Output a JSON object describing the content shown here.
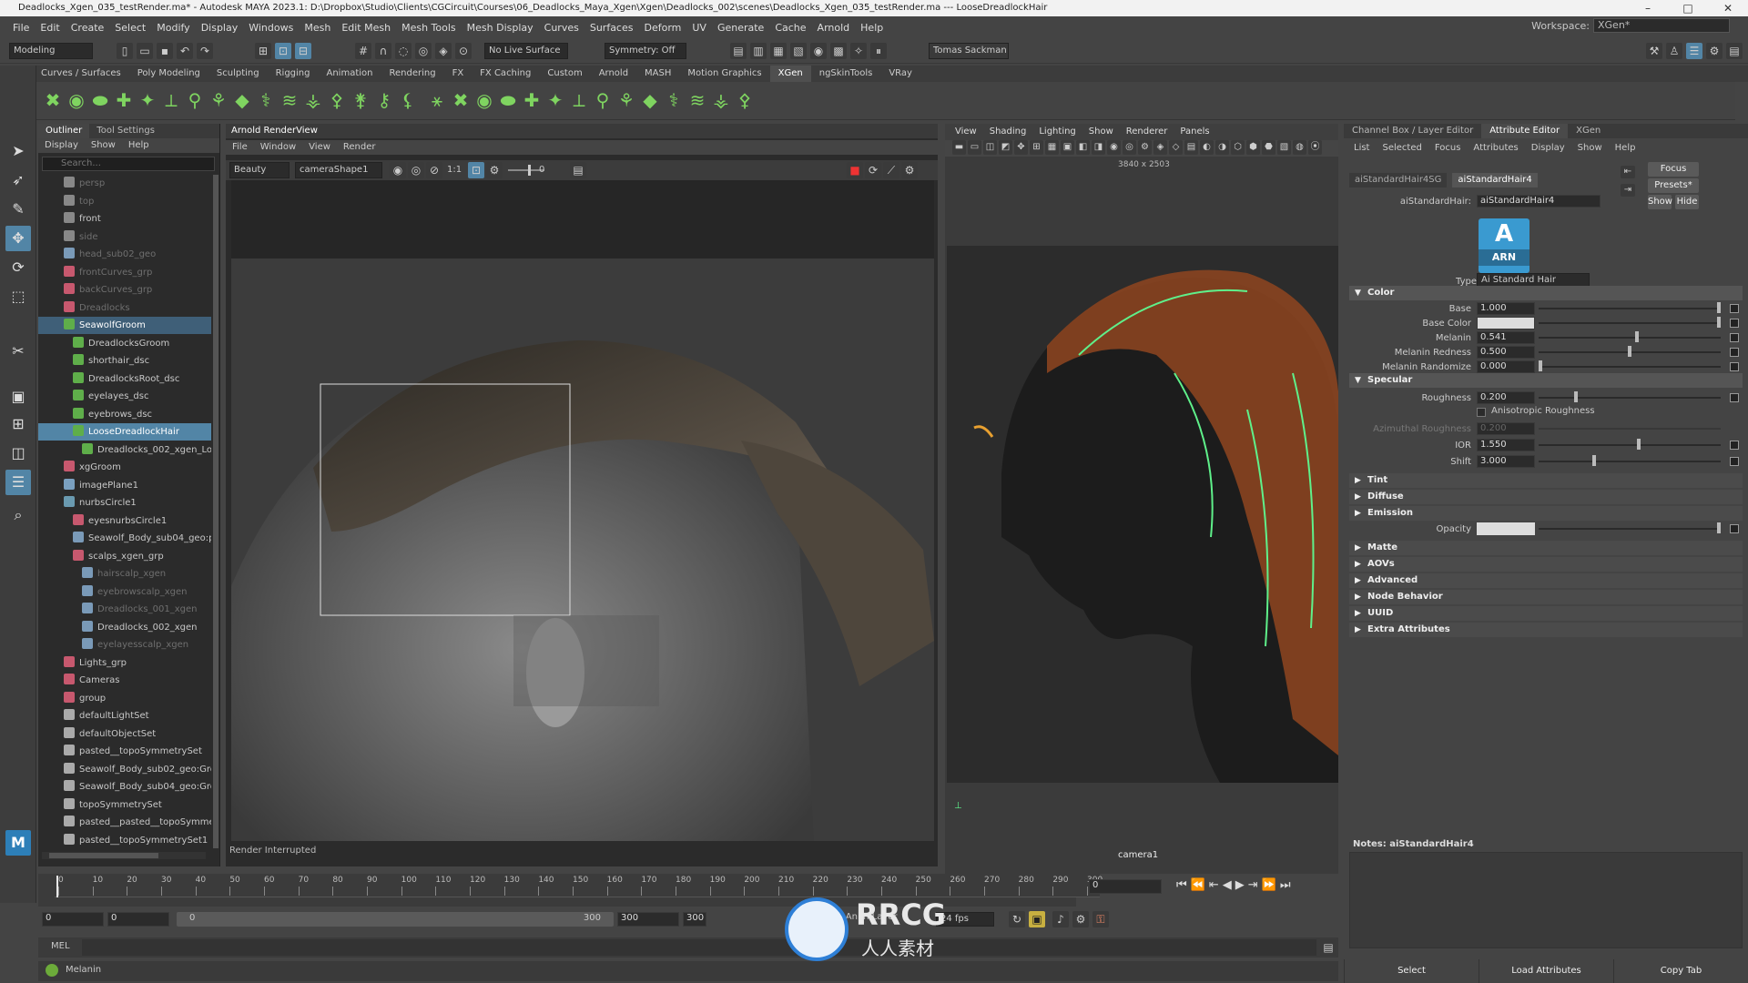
{
  "titlebar": {
    "text": "Deadlocks_Xgen_035_testRender.ma* - Autodesk MAYA 2023.1: D:\\Dropbox\\Studio\\Clients\\CGCircuit\\Courses\\06_Deadlocks_Maya_Xgen\\Xgen\\Deadlocks_002\\scenes\\Deadlocks_Xgen_035_testRender.ma --- LooseDreadlockHair"
  },
  "menubar": [
    "File",
    "Edit",
    "Create",
    "Select",
    "Modify",
    "Display",
    "Windows",
    "Mesh",
    "Edit Mesh",
    "Mesh Tools",
    "Mesh Display",
    "Curves",
    "Surfaces",
    "Deform",
    "UV",
    "Generate",
    "Cache",
    "Arnold",
    "Help"
  ],
  "workspace": {
    "label": "Workspace:",
    "value": "XGen*"
  },
  "statusline": {
    "mode": "Modeling",
    "live_surface": "No Live Surface",
    "symmetry": "Symmetry: Off",
    "user": "Tomas Sackman"
  },
  "shelf_tabs": [
    "Curves / Surfaces",
    "Poly Modeling",
    "Sculpting",
    "Rigging",
    "Animation",
    "Rendering",
    "FX",
    "FX Caching",
    "Custom",
    "Arnold",
    "MASH",
    "Motion Graphics",
    "XGen",
    "ngSkinTools",
    "VRay"
  ],
  "shelf_active": "XGen",
  "outliner": {
    "tabs": [
      "Outliner",
      "Tool Settings"
    ],
    "menu": [
      "Display",
      "Show",
      "Help"
    ],
    "search_placeholder": "Search...",
    "rows": [
      {
        "label": "persp",
        "indent": 2,
        "type": "camera",
        "state": "dim"
      },
      {
        "label": "top",
        "indent": 2,
        "type": "camera",
        "state": "dim"
      },
      {
        "label": "front",
        "indent": 2,
        "type": "camera",
        "state": ""
      },
      {
        "label": "side",
        "indent": 2,
        "type": "camera",
        "state": "dim"
      },
      {
        "label": "head_sub02_geo",
        "indent": 2,
        "type": "mesh",
        "state": "dim"
      },
      {
        "label": "frontCurves_grp",
        "indent": 2,
        "type": "group",
        "state": "dim"
      },
      {
        "label": "backCurves_grp",
        "indent": 2,
        "type": "group",
        "state": "dim"
      },
      {
        "label": "Dreadlocks",
        "indent": 2,
        "type": "group",
        "state": "dim"
      },
      {
        "label": "SeawolfGroom",
        "indent": 2,
        "type": "xgen",
        "state": "sel2"
      },
      {
        "label": "DreadlocksGroom",
        "indent": 3,
        "type": "xgen",
        "state": ""
      },
      {
        "label": "shorthair_dsc",
        "indent": 3,
        "type": "xgen",
        "state": ""
      },
      {
        "label": "DreadlocksRoot_dsc",
        "indent": 3,
        "type": "xgen",
        "state": ""
      },
      {
        "label": "eyelayes_dsc",
        "indent": 3,
        "type": "xgen",
        "state": ""
      },
      {
        "label": "eyebrows_dsc",
        "indent": 3,
        "type": "xgen",
        "state": ""
      },
      {
        "label": "LooseDreadlockHair",
        "indent": 3,
        "type": "xgen",
        "state": "sel"
      },
      {
        "label": "Dreadlocks_002_xgen_Lo",
        "indent": 4,
        "type": "patch",
        "state": ""
      },
      {
        "label": "xgGroom",
        "indent": 2,
        "type": "group",
        "state": ""
      },
      {
        "label": "imagePlane1",
        "indent": 2,
        "type": "image",
        "state": ""
      },
      {
        "label": "nurbsCircle1",
        "indent": 2,
        "type": "curve",
        "state": ""
      },
      {
        "label": "eyesnurbsCircle1",
        "indent": 3,
        "type": "group",
        "state": ""
      },
      {
        "label": "Seawolf_Body_sub04_geo:pl",
        "indent": 3,
        "type": "mesh",
        "state": ""
      },
      {
        "label": "scalps_xgen_grp",
        "indent": 3,
        "type": "group",
        "state": ""
      },
      {
        "label": "hairscalp_xgen",
        "indent": 4,
        "type": "mesh",
        "state": "dim"
      },
      {
        "label": "eyebrowscalp_xgen",
        "indent": 4,
        "type": "mesh",
        "state": "dim"
      },
      {
        "label": "Dreadlocks_001_xgen",
        "indent": 4,
        "type": "mesh",
        "state": "dim"
      },
      {
        "label": "Dreadlocks_002_xgen",
        "indent": 4,
        "type": "mesh",
        "state": ""
      },
      {
        "label": "eyelayesscalp_xgen",
        "indent": 4,
        "type": "mesh",
        "state": "dim"
      },
      {
        "label": "Lights_grp",
        "indent": 2,
        "type": "group",
        "state": ""
      },
      {
        "label": "Cameras",
        "indent": 2,
        "type": "group",
        "state": ""
      },
      {
        "label": "group",
        "indent": 2,
        "type": "group",
        "state": ""
      },
      {
        "label": "defaultLightSet",
        "indent": 2,
        "type": "set",
        "state": ""
      },
      {
        "label": "defaultObjectSet",
        "indent": 2,
        "type": "set",
        "state": ""
      },
      {
        "label": "pasted__topoSymmetrySet",
        "indent": 2,
        "type": "set",
        "state": ""
      },
      {
        "label": "Seawolf_Body_sub02_geo:Grou",
        "indent": 2,
        "type": "set",
        "state": ""
      },
      {
        "label": "Seawolf_Body_sub04_geo:Grou",
        "indent": 2,
        "type": "set",
        "state": ""
      },
      {
        "label": "topoSymmetrySet",
        "indent": 2,
        "type": "set",
        "state": ""
      },
      {
        "label": "pasted__pasted__topoSymmetr",
        "indent": 2,
        "type": "set",
        "state": ""
      },
      {
        "label": "pasted__topoSymmetrySet1",
        "indent": 2,
        "type": "set",
        "state": ""
      }
    ]
  },
  "renderview": {
    "title": "Arnold RenderView",
    "menu": [
      "File",
      "Window",
      "View",
      "Render"
    ],
    "aov": "Beauty",
    "camera": "cameraShape1",
    "ratio": "1:1",
    "exposure": "0",
    "status": "Render Interrupted"
  },
  "viewport": {
    "menu": [
      "View",
      "Shading",
      "Lighting",
      "Show",
      "Renderer",
      "Panels"
    ],
    "resolution": "3840 x 2503",
    "camera_label": "camera1"
  },
  "attribute_editor": {
    "tabs": [
      "Channel Box / Layer Editor",
      "Attribute Editor",
      "XGen"
    ],
    "active_tab": "Attribute Editor",
    "menu": [
      "List",
      "Selected",
      "Focus",
      "Attributes",
      "Display",
      "Show",
      "Help"
    ],
    "node_tabs": [
      "aiStandardHair4SG",
      "aiStandardHair4"
    ],
    "active_node_tab": "aiStandardHair4",
    "node_label": "aiStandardHair:",
    "node_value": "aiStandardHair4",
    "buttons": {
      "focus": "Focus",
      "presets": "Presets*",
      "show": "Show",
      "hide": "Hide"
    },
    "logo_letter": "A",
    "logo_text": "ARN",
    "type_label": "Type",
    "type_value": "Ai Standard Hair",
    "sections": {
      "color": "Color",
      "specular": "Specular",
      "tint": "Tint",
      "diffuse": "Diffuse",
      "emission": "Emission",
      "matte": "Matte",
      "aovs": "AOVs",
      "advanced": "Advanced",
      "node_behavior": "Node Behavior",
      "uuid": "UUID",
      "extra": "Extra Attributes"
    },
    "color_attrs": [
      {
        "label": "Base",
        "value": "1.000",
        "level": 1.0
      },
      {
        "label": "Base Color",
        "value": "",
        "level": 1.0
      },
      {
        "label": "Melanin",
        "value": "0.541",
        "level": 0.541
      },
      {
        "label": "Melanin Redness",
        "value": "0.500",
        "level": 0.5
      },
      {
        "label": "Melanin Randomize",
        "value": "0.000",
        "level": 0.0
      }
    ],
    "specular_attrs": {
      "roughness": {
        "label": "Roughness",
        "value": "0.200",
        "level": 0.2
      },
      "aniso_label": "Anisotropic Roughness",
      "azimuthal": {
        "label": "Azimuthal Roughness",
        "value": "0.200",
        "level": 0.2
      },
      "ior": {
        "label": "IOR",
        "value": "1.550",
        "level": 0.55
      },
      "shift": {
        "label": "Shift",
        "value": "3.000",
        "level": 0.3
      }
    },
    "opacity_label": "Opacity",
    "notes_label": "Notes: aiStandardHair4",
    "bottom_buttons": [
      "Select",
      "Load Attributes",
      "Copy Tab"
    ]
  },
  "timeslider": {
    "ticks": [
      "0",
      "10",
      "20",
      "30",
      "40",
      "50",
      "60",
      "70",
      "80",
      "90",
      "100",
      "110",
      "120",
      "130",
      "140",
      "150",
      "160",
      "170",
      "180",
      "190",
      "200",
      "210",
      "220",
      "230",
      "240",
      "250",
      "260",
      "270",
      "280",
      "290",
      "300"
    ],
    "current_frame": "0"
  },
  "rangeslider": {
    "start": "0",
    "inner_start": "0",
    "range_start": "0",
    "range_end": "300",
    "end": "300",
    "end2": "300",
    "anim_layer": "No Anim Layer",
    "fps": "24 fps"
  },
  "cmdline": {
    "lang": "MEL"
  },
  "helpline": {
    "text": "Melanin"
  },
  "watermark": {
    "main": "RRCG",
    "sub": "人人素材"
  }
}
